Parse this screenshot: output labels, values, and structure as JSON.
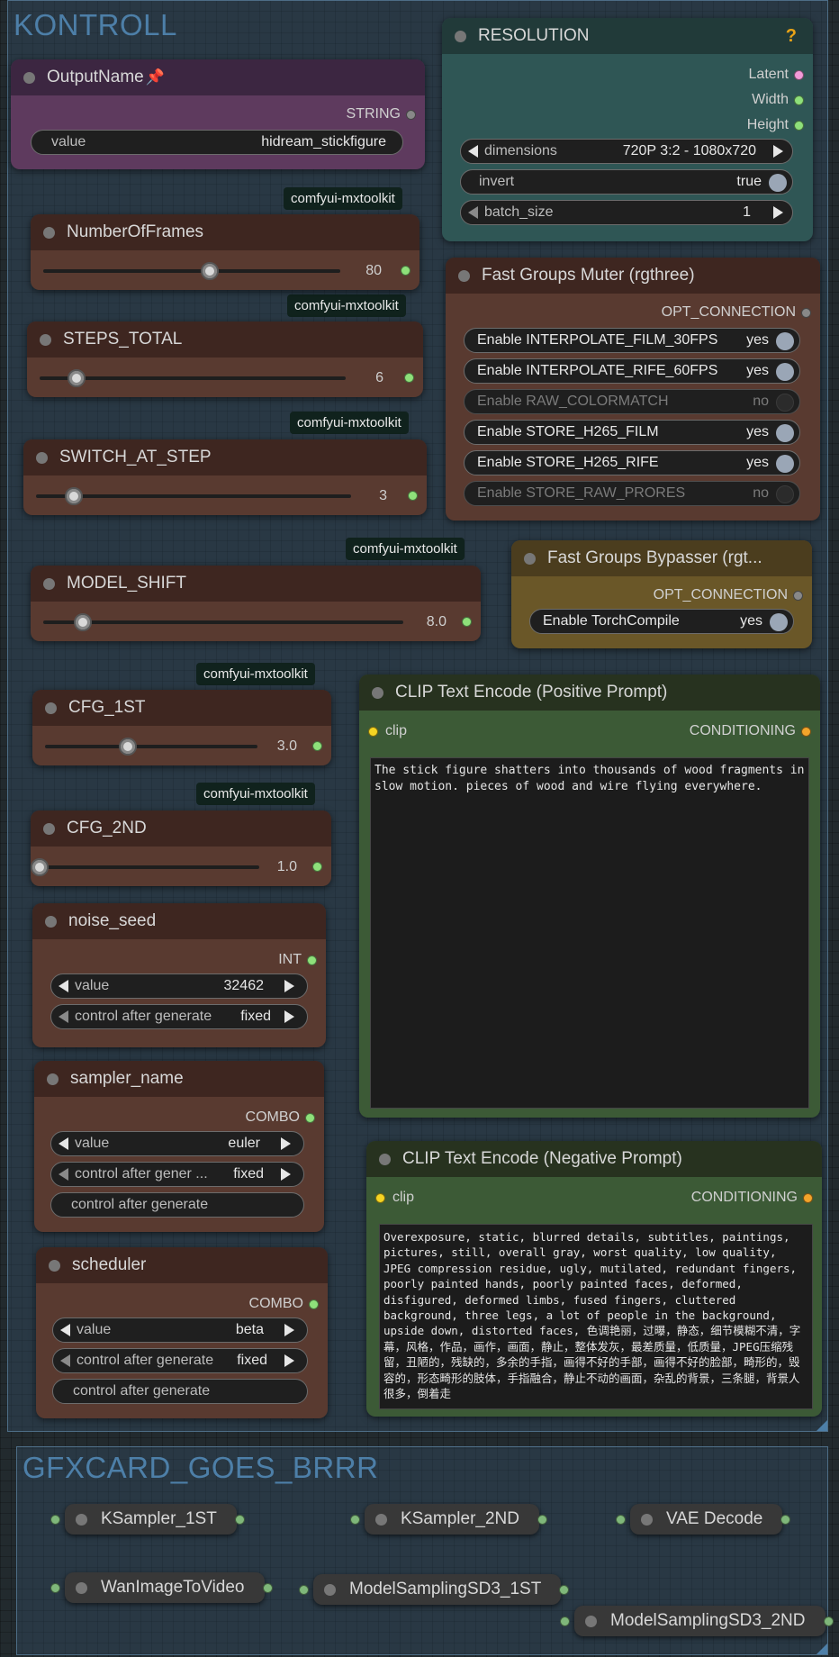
{
  "groups": {
    "kontroll": "KONTROLL",
    "gfx": "GFXCARD_GOES_BRRR"
  },
  "badge": "comfyui-mxtoolkit",
  "output_name": {
    "title": "OutputName",
    "pin_icon": "pin-icon",
    "output": "STRING",
    "value_label": "value",
    "value": "hidream_stickfigure"
  },
  "resolution": {
    "title": "RESOLUTION",
    "help": "?",
    "outputs": [
      "Latent",
      "Width",
      "Height"
    ],
    "dimensions_label": "dimensions",
    "dimensions_value": "720P 3:2 - 1080x720",
    "invert_label": "invert",
    "invert_value": "true",
    "batch_label": "batch_size",
    "batch_value": "1"
  },
  "sliders": [
    {
      "title": "NumberOfFrames",
      "value": "80",
      "fraction": 0.56
    },
    {
      "title": "STEPS_TOTAL",
      "value": "6",
      "fraction": 0.12
    },
    {
      "title": "SWITCH_AT_STEP",
      "value": "3",
      "fraction": 0.12
    },
    {
      "title": "MODEL_SHIFT",
      "value": "8.0",
      "fraction": 0.11
    },
    {
      "title": "CFG_1ST",
      "value": "3.0",
      "fraction": 0.39
    },
    {
      "title": "CFG_2ND",
      "value": "1.0",
      "fraction": 0.0
    }
  ],
  "muter": {
    "title": "Fast Groups Muter (rgthree)",
    "output": "OPT_CONNECTION",
    "toggles": [
      {
        "label": "Enable INTERPOLATE_FILM_30FPS",
        "value": "yes",
        "on": true
      },
      {
        "label": "Enable INTERPOLATE_RIFE_60FPS",
        "value": "yes",
        "on": true
      },
      {
        "label": "Enable RAW_COLORMATCH",
        "value": "no",
        "on": false
      },
      {
        "label": "Enable STORE_H265_FILM",
        "value": "yes",
        "on": true
      },
      {
        "label": "Enable STORE_H265_RIFE",
        "value": "yes",
        "on": true
      },
      {
        "label": "Enable STORE_RAW_PRORES",
        "value": "no",
        "on": false
      }
    ]
  },
  "bypasser": {
    "title": "Fast Groups Bypasser (rgt...",
    "output": "OPT_CONNECTION",
    "toggle_label": "Enable TorchCompile",
    "toggle_value": "yes"
  },
  "clip_pos": {
    "title": "CLIP Text Encode (Positive Prompt)",
    "input": "clip",
    "output": "CONDITIONING",
    "text": "The stick figure shatters into thousands of wood fragments in slow motion. pieces of wood and wire flying everywhere."
  },
  "clip_neg": {
    "title": "CLIP Text Encode (Negative Prompt)",
    "input": "clip",
    "output": "CONDITIONING",
    "text": "Overexposure, static, blurred details, subtitles, paintings, pictures, still, overall gray, worst quality, low quality, JPEG compression residue, ugly, mutilated, redundant fingers, poorly painted hands, poorly painted faces, deformed, disfigured, deformed limbs, fused fingers, cluttered background, three legs, a lot of people in the background, upside down, distorted faces, 色调艳丽，过曝，静态，细节模糊不清，字幕，风格，作品，画作，画面，静止，整体发灰，最差质量，低质量，JPEG压缩残留，丑陋的，残缺的，多余的手指，画得不好的手部，画得不好的脸部，畸形的，毁容的，形态畸形的肢体，手指融合，静止不动的画面，杂乱的背景，三条腿，背景人很多，倒着走"
  },
  "noise_seed": {
    "title": "noise_seed",
    "output": "INT",
    "value_label": "value",
    "value": "32462",
    "control_label": "control after generate",
    "control_value": "fixed"
  },
  "sampler": {
    "title": "sampler_name",
    "output": "COMBO",
    "value_label": "value",
    "value": "euler",
    "control_label": "control after gener ...",
    "control_value": "fixed",
    "extra_label": "control after generate"
  },
  "scheduler": {
    "title": "scheduler",
    "output": "COMBO",
    "value_label": "value",
    "value": "beta",
    "control_label": "control after generate",
    "control_value": "fixed",
    "extra_label": "control after generate"
  },
  "gfx_nodes": [
    "KSampler_1ST",
    "KSampler_2ND",
    "VAE Decode",
    "WanImageToVideo",
    "ModelSamplingSD3_1ST",
    "ModelSamplingSD3_2ND"
  ]
}
